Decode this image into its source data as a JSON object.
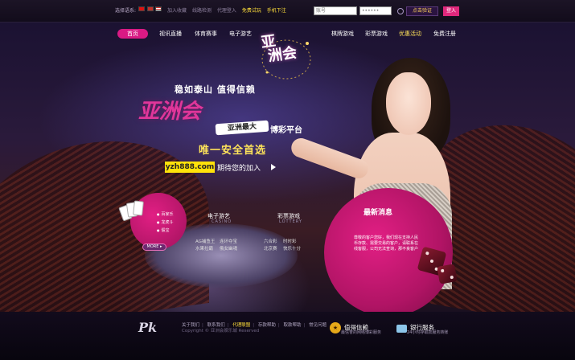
{
  "topbar": {
    "lang_label": "选择语系:",
    "links": [
      "加入收藏",
      "线路检测",
      "代理登入"
    ],
    "highlight_links": [
      "免费试玩",
      "手机下注"
    ],
    "username_placeholder": "账号",
    "password_placeholder": "••••••",
    "verify_label": "点击验证",
    "login_label": "登入"
  },
  "nav": {
    "items": [
      "首页",
      "视讯直播",
      "体育赛事",
      "电子游艺",
      "棋牌游戏",
      "彩票游戏",
      "优惠活动",
      "免费注册"
    ],
    "active_index": 0,
    "highlight_index": 6
  },
  "logo": {
    "line1": "亚",
    "line2": "洲会"
  },
  "hero": {
    "slogan1": "稳如泰山  值得信赖",
    "brand": "亚洲会",
    "tag": "亚洲最大",
    "slogan2": "博彩平台",
    "slogan3": "唯一安全首选",
    "url": "yzh888.com",
    "slogan4": "期待您的加入"
  },
  "games": {
    "featured": [
      "百家乐",
      "龙虎斗",
      "骰宝"
    ],
    "more_label": "MORE",
    "electronic": {
      "title": "电子游艺",
      "subtitle": "CASINO",
      "links": [
        "AG捕鱼王",
        "连环夺宝",
        "水果拉霸",
        "俄女幽魂"
      ]
    },
    "lottery": {
      "title": "彩票游戏",
      "subtitle": "LOTTERY",
      "links": [
        "六合彩",
        "时时彩",
        "北京赛",
        "快乐十分"
      ]
    }
  },
  "news": {
    "title": "最新消息",
    "body": "尊敬的客户您好，我们现在支持人民币存款、需要交易的客户，请联系在线客服，公司无法查询，那不良客户"
  },
  "footer": {
    "logo": "Pk",
    "links": [
      "关于我们",
      "联系我们",
      "代理联盟",
      "存款帮助",
      "取款帮助",
      "常见问题"
    ],
    "highlight_index": 2,
    "copyright": "Copyright © 亚洲会娱乐城 Reserved",
    "badges": [
      {
        "title": "值得信赖",
        "sub": "最信誉的网络博彩服务"
      },
      {
        "title": "银行服务",
        "sub": "24小时存取款服务转账"
      }
    ]
  },
  "colors": {
    "accent": "#d91a84",
    "gold": "#ffe25a",
    "background": "#0c0716"
  }
}
